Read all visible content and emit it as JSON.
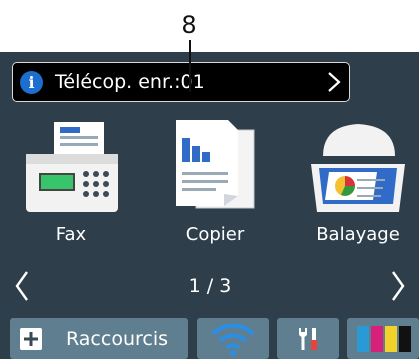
{
  "callout": {
    "number": "8"
  },
  "notification": {
    "text": "Télécop. enr.:01"
  },
  "apps": [
    {
      "label": "Fax"
    },
    {
      "label": "Copier"
    },
    {
      "label": "Balayage"
    }
  ],
  "pager": {
    "text": "1 / 3"
  },
  "bottom": {
    "shortcut_label": "Raccourcis"
  },
  "colors": {
    "screen_bg": "#2e3e4a",
    "button_bg": "#5f7f90",
    "info_blue": "#1c6fcf",
    "wifi_blue": "#2a8ee6",
    "ink": [
      "#2a9ad6",
      "#d6207a",
      "#f2d22a",
      "#111111"
    ]
  }
}
